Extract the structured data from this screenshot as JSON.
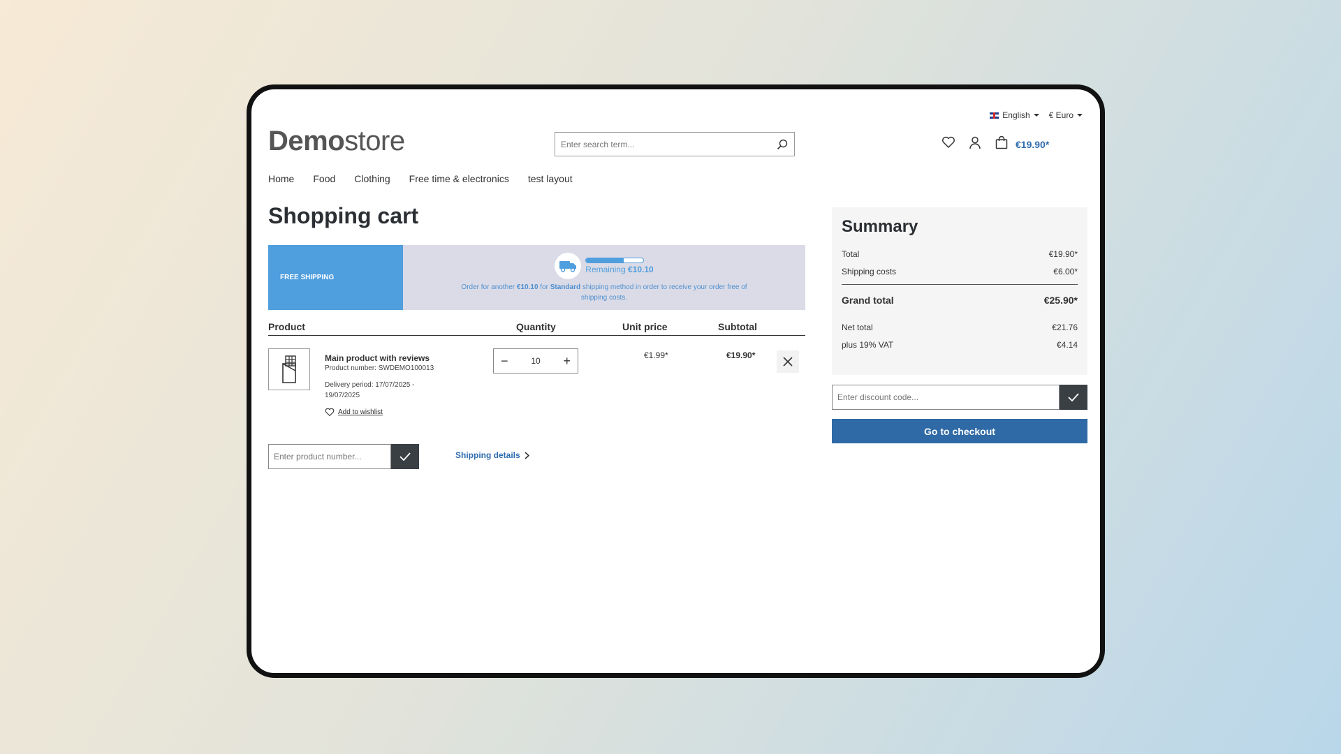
{
  "topbar": {
    "language": "English",
    "currency": "€ Euro"
  },
  "logo": {
    "bold": "Demo",
    "light": "store"
  },
  "search": {
    "placeholder": "Enter search term..."
  },
  "header": {
    "cart_total": "€19.90*"
  },
  "nav": {
    "items": [
      "Home",
      "Food",
      "Clothing",
      "Free time & electronics",
      "test layout"
    ]
  },
  "page": {
    "title": "Shopping cart"
  },
  "shipping_banner": {
    "label": "FREE SHIPPING",
    "remaining_prefix": "Remaining",
    "remaining_amount": "€10.10",
    "progress": 0.66,
    "desc_1": "Order for another",
    "desc_amount": "€10.10",
    "desc_2": "for",
    "desc_method": "Standard",
    "desc_3": "shipping method in order to receive your order free of shipping costs."
  },
  "table": {
    "headers": {
      "product": "Product",
      "quantity": "Quantity",
      "unit_price": "Unit price",
      "subtotal": "Subtotal"
    }
  },
  "item": {
    "name": "Main product with reviews",
    "number": "Product number: SWDEMO100013",
    "delivery": "Delivery period: 17/07/2025 - 19/07/2025",
    "wishlist": "Add to wishlist",
    "quantity": "10",
    "unit_price": "€1.99*",
    "subtotal": "€19.90*"
  },
  "add_product": {
    "placeholder": "Enter product number..."
  },
  "shipping_details": "Shipping details",
  "summary": {
    "title": "Summary",
    "rows": [
      {
        "label": "Total",
        "value": "€19.90*"
      },
      {
        "label": "Shipping costs",
        "value": "€6.00*"
      }
    ],
    "grand_total": {
      "label": "Grand total",
      "value": "€25.90*"
    },
    "tax_rows": [
      {
        "label": "Net total",
        "value": "€21.76"
      },
      {
        "label": "plus 19% VAT",
        "value": "€4.14"
      }
    ]
  },
  "discount": {
    "placeholder": "Enter discount code..."
  },
  "checkout": {
    "label": "Go to checkout"
  }
}
